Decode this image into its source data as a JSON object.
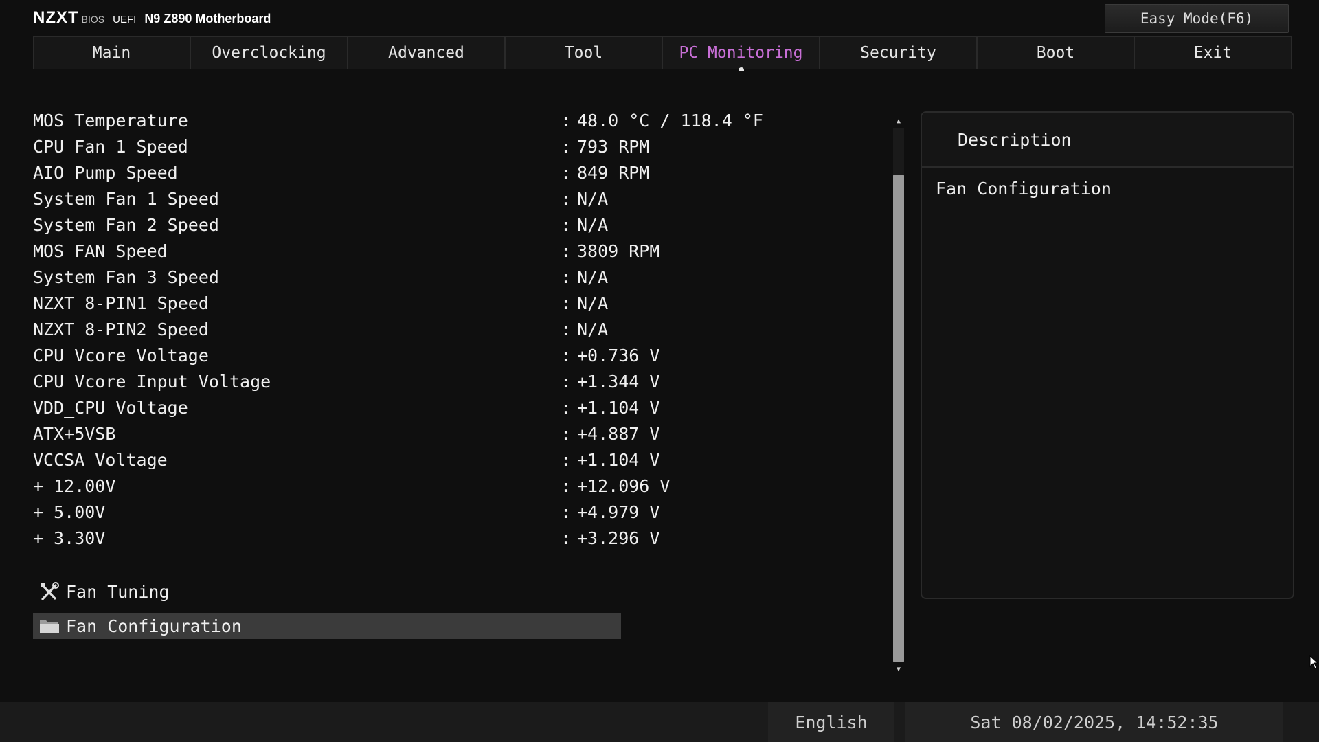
{
  "header": {
    "logo": "NZXT",
    "bios": "BIOS",
    "uefi": "UEFI",
    "model": "N9 Z890 Motherboard",
    "easy_mode": "Easy Mode(F6)"
  },
  "tabs": [
    {
      "label": "Main"
    },
    {
      "label": "Overclocking"
    },
    {
      "label": "Advanced"
    },
    {
      "label": "Tool"
    },
    {
      "label": "PC Monitoring",
      "active": true
    },
    {
      "label": "Security"
    },
    {
      "label": "Boot"
    },
    {
      "label": "Exit"
    }
  ],
  "monitor": {
    "separator": ":",
    "rows": [
      {
        "label": "MOS Temperature",
        "value": "48.0 °C / 118.4 °F"
      },
      {
        "label": "CPU Fan 1 Speed",
        "value": "793 RPM"
      },
      {
        "label": "AIO Pump Speed",
        "value": "849 RPM"
      },
      {
        "label": "System Fan 1 Speed",
        "value": "N/A"
      },
      {
        "label": "System Fan 2 Speed",
        "value": "N/A"
      },
      {
        "label": "MOS FAN Speed",
        "value": "3809 RPM"
      },
      {
        "label": "System Fan 3 Speed",
        "value": "N/A"
      },
      {
        "label": "NZXT 8-PIN1 Speed",
        "value": "N/A"
      },
      {
        "label": "NZXT 8-PIN2 Speed",
        "value": "N/A"
      },
      {
        "label": "CPU Vcore Voltage",
        "value": "+0.736 V"
      },
      {
        "label": "CPU Vcore Input Voltage",
        "value": "+1.344 V"
      },
      {
        "label": "VDD_CPU Voltage",
        "value": "+1.104 V"
      },
      {
        "label": "ATX+5VSB",
        "value": "+4.887 V"
      },
      {
        "label": "VCCSA Voltage",
        "value": "+1.104 V"
      },
      {
        "label": "+ 12.00V",
        "value": "+12.096 V"
      },
      {
        "label": "+ 5.00V",
        "value": "+4.979 V"
      },
      {
        "label": "+ 3.30V",
        "value": "+3.296 V"
      }
    ]
  },
  "menu": {
    "fan_tuning": "Fan Tuning",
    "fan_configuration": "Fan Configuration"
  },
  "description": {
    "title": "Description",
    "text": "Fan Configuration"
  },
  "footer": {
    "language": "English",
    "datetime": "Sat 08/02/2025, 14:52:35"
  },
  "icons": {
    "fan_tuning": "tools-icon",
    "fan_configuration": "folder-icon"
  }
}
